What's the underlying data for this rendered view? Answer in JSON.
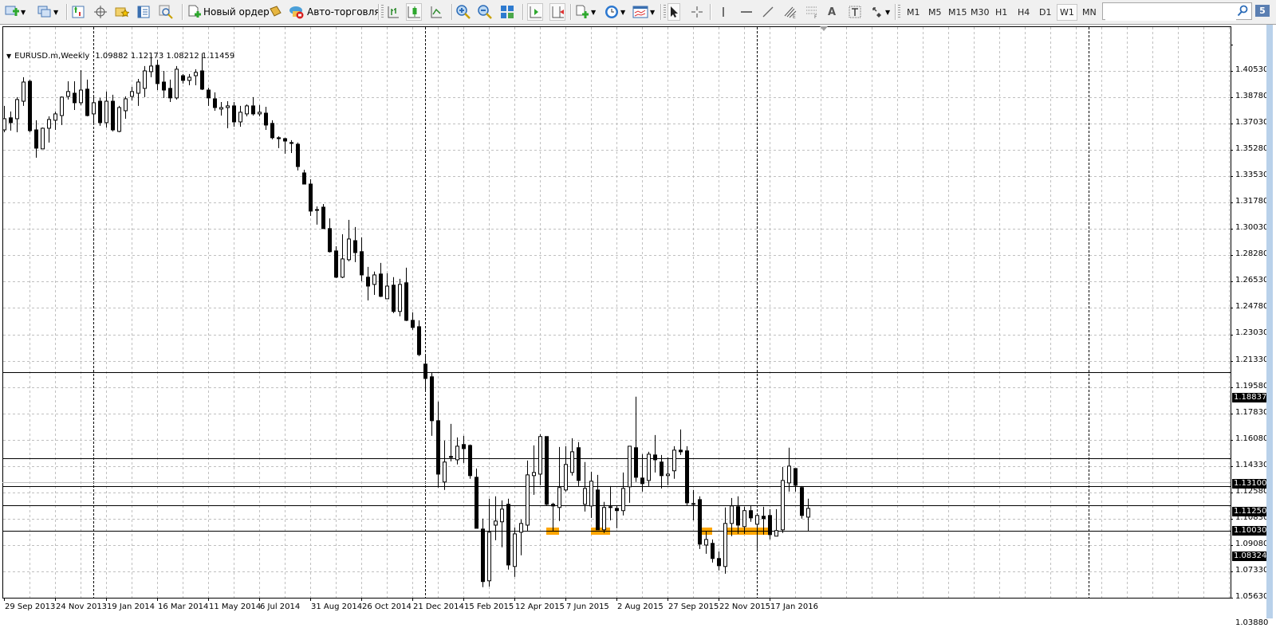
{
  "toolbar": {
    "new_order_label": "Новый ордер",
    "auto_trading_label": "Авто-торговля",
    "timeframes": [
      "M1",
      "M5",
      "M15",
      "M30",
      "H1",
      "H4",
      "D1",
      "W1",
      "MN"
    ],
    "active_timeframe": "W1",
    "search_value": "",
    "notification_count": "5",
    "icons": [
      "new-chart",
      "profiles",
      "market-watch",
      "navigator",
      "favorites",
      "terminal",
      "strategy-tester",
      "new-order",
      "metaeditor",
      "auto-trading",
      "bar-chart",
      "candlesticks",
      "line-chart",
      "zoom-in",
      "zoom-out",
      "tile-windows",
      "auto-scroll",
      "chart-shift",
      "indicators",
      "periods",
      "templates",
      "cursor",
      "crosshair",
      "vertical-line",
      "horizontal-line",
      "trendline",
      "fibonacci-fan",
      "fibonacci-retracement",
      "text",
      "text-label",
      "arrows",
      "search",
      "notifications"
    ]
  },
  "chart": {
    "symbol": "EURUSD.m,Weekly",
    "ohlc_text": "1.09882 1.12173 1.08212 1.11459"
  },
  "chart_data": {
    "type": "candlestick",
    "title": "EURUSD.m,Weekly",
    "first_bar_date": "2013-09-29",
    "bar_period": "W1",
    "ylim": [
      1.0388,
      1.4053
    ],
    "grid": true,
    "y_tick_labels": [
      "1.40530",
      "1.38780",
      "1.37030",
      "1.35280",
      "1.33530",
      "1.31780",
      "1.30030",
      "1.28280",
      "1.26530",
      "1.24780",
      "1.23030",
      "1.21330",
      "1.19580",
      "1.17830",
      "1.16080",
      "1.14330",
      "1.12580",
      "1.10830",
      "1.09080",
      "1.07330",
      "1.05630",
      "1.03880"
    ],
    "x_tick_labels": [
      "29 Sep 2013",
      "24 Nov 2013",
      "19 Jan 2014",
      "16 Mar 2014",
      "11 May 2014",
      "6 Jul 2014",
      "31 Aug 2014",
      "26 Oct 2014",
      "21 Dec 2014",
      "15 Feb 2015",
      "12 Apr 2015",
      "7 Jun 2015",
      "2 Aug 2015",
      "27 Sep 2015",
      "22 Nov 2015",
      "17 Jan 2016"
    ],
    "ohlc": [
      [
        1.3488,
        1.3647,
        1.3473,
        1.3562
      ],
      [
        1.3568,
        1.361,
        1.3483,
        1.3536
      ],
      [
        1.3562,
        1.3705,
        1.3473,
        1.3689
      ],
      [
        1.3678,
        1.3837,
        1.3647,
        1.3805
      ],
      [
        1.381,
        1.3821,
        1.3473,
        1.3483
      ],
      [
        1.3488,
        1.3552,
        1.3304,
        1.3367
      ],
      [
        1.3362,
        1.3504,
        1.3362,
        1.3499
      ],
      [
        1.3499,
        1.3578,
        1.3404,
        1.3557
      ],
      [
        1.3552,
        1.361,
        1.3488,
        1.3594
      ],
      [
        1.3583,
        1.371,
        1.352,
        1.3705
      ],
      [
        1.371,
        1.381,
        1.3689,
        1.3742
      ],
      [
        1.3731,
        1.381,
        1.362,
        1.3668
      ],
      [
        1.3668,
        1.3884,
        1.3652,
        1.3752
      ],
      [
        1.3758,
        1.3821,
        1.3578,
        1.3583
      ],
      [
        1.3594,
        1.3705,
        1.3531,
        1.3668
      ],
      [
        1.3678,
        1.37,
        1.3515,
        1.3536
      ],
      [
        1.3536,
        1.3742,
        1.3504,
        1.3678
      ],
      [
        1.3678,
        1.3721,
        1.3478,
        1.3488
      ],
      [
        1.3478,
        1.3647,
        1.3473,
        1.3636
      ],
      [
        1.3615,
        1.371,
        1.3562,
        1.3694
      ],
      [
        1.371,
        1.3773,
        1.3684,
        1.3742
      ],
      [
        1.3731,
        1.3826,
        1.3647,
        1.3805
      ],
      [
        1.3763,
        1.3911,
        1.3705,
        1.3879
      ],
      [
        1.3874,
        1.3969,
        1.3837,
        1.3911
      ],
      [
        1.3916,
        1.3953,
        1.3752,
        1.3795
      ],
      [
        1.3805,
        1.3879,
        1.37,
        1.3752
      ],
      [
        1.3763,
        1.3821,
        1.3673,
        1.37
      ],
      [
        1.37,
        1.3911,
        1.3689,
        1.389
      ],
      [
        1.3847,
        1.3858,
        1.3795,
        1.3816
      ],
      [
        1.3816,
        1.3858,
        1.3784,
        1.3837
      ],
      [
        1.3847,
        1.389,
        1.3784,
        1.3869
      ],
      [
        1.3879,
        1.3995,
        1.3752,
        1.3758
      ],
      [
        1.3752,
        1.3768,
        1.3647,
        1.37
      ],
      [
        1.3694,
        1.3737,
        1.3615,
        1.3636
      ],
      [
        1.3626,
        1.3673,
        1.3583,
        1.3636
      ],
      [
        1.3636,
        1.3678,
        1.3499,
        1.3647
      ],
      [
        1.3647,
        1.3673,
        1.3509,
        1.3541
      ],
      [
        1.3541,
        1.3647,
        1.3509,
        1.3605
      ],
      [
        1.3594,
        1.3657,
        1.3578,
        1.3647
      ],
      [
        1.3647,
        1.3705,
        1.3583,
        1.3594
      ],
      [
        1.3594,
        1.3652,
        1.3578,
        1.3605
      ],
      [
        1.3599,
        1.3641,
        1.3488,
        1.352
      ],
      [
        1.3531,
        1.3552,
        1.3425,
        1.3436
      ],
      [
        1.3436,
        1.3446,
        1.3367,
        1.343
      ],
      [
        1.343,
        1.3436,
        1.333,
        1.3414
      ],
      [
        1.3404,
        1.342,
        1.3335,
        1.3399
      ],
      [
        1.3393,
        1.3404,
        1.3219,
        1.3245
      ],
      [
        1.3203,
        1.3224,
        1.3129,
        1.3129
      ],
      [
        1.3129,
        1.3161,
        1.2918,
        1.295
      ],
      [
        1.296,
        1.2981,
        1.286,
        1.2955
      ],
      [
        1.2976,
        1.2997,
        1.2834,
        1.2834
      ],
      [
        1.2834,
        1.2902,
        1.2675,
        1.2681
      ],
      [
        1.2686,
        1.2717,
        1.2506,
        1.2512
      ],
      [
        1.2512,
        1.2797,
        1.2506,
        1.2633
      ],
      [
        1.2628,
        1.2892,
        1.2617,
        1.2765
      ],
      [
        1.2754,
        1.2844,
        1.2612,
        1.2675
      ],
      [
        1.2681,
        1.2776,
        1.2485,
        1.2527
      ],
      [
        1.2512,
        1.258,
        1.2358,
        1.2453
      ],
      [
        1.2464,
        1.2549,
        1.2395,
        1.2527
      ],
      [
        1.2533,
        1.2607,
        1.238,
        1.2385
      ],
      [
        1.2369,
        1.2538,
        1.2369,
        1.2453
      ],
      [
        1.2459,
        1.2512,
        1.2274,
        1.2285
      ],
      [
        1.2285,
        1.2501,
        1.2253,
        1.2464
      ],
      [
        1.2475,
        1.2575,
        1.2221,
        1.2226
      ],
      [
        1.2226,
        1.2279,
        1.2163,
        1.2179
      ],
      [
        1.2184,
        1.2226,
        1.1989,
        1.1999
      ],
      [
        1.1936,
        1.1994,
        1.1757,
        1.1841
      ],
      [
        1.1852,
        1.1878,
        1.1461,
        1.1561
      ],
      [
        1.1561,
        1.1688,
        1.1118,
        1.1207
      ],
      [
        1.1155,
        1.1429,
        1.1102,
        1.1287
      ],
      [
        1.1324,
        1.154,
        1.1292,
        1.1318
      ],
      [
        1.1302,
        1.145,
        1.1271,
        1.1392
      ],
      [
        1.1403,
        1.1461,
        1.1281,
        1.1376
      ],
      [
        1.1397,
        1.1403,
        1.1176,
        1.1197
      ],
      [
        1.1186,
        1.1244,
        1.0848,
        1.0848
      ],
      [
        1.0843,
        1.0912,
        1.0458,
        1.0495
      ],
      [
        1.05,
        1.1044,
        1.0462,
        1.0822
      ],
      [
        1.0869,
        1.106,
        1.0769,
        1.0896
      ],
      [
        1.0891,
        1.1033,
        1.0722,
        1.0975
      ],
      [
        1.1007,
        1.1044,
        1.0574,
        1.0605
      ],
      [
        1.0595,
        1.0854,
        1.0526,
        1.0811
      ],
      [
        1.0822,
        1.0906,
        1.0669,
        1.088
      ],
      [
        1.0869,
        1.1297,
        1.0827,
        1.1202
      ],
      [
        1.1197,
        1.1397,
        1.107,
        1.1218
      ],
      [
        1.1207,
        1.1471,
        1.1133,
        1.1456
      ],
      [
        1.1456,
        1.1456,
        1.1001,
        1.1007
      ],
      [
        1.1007,
        1.1017,
        1.0827,
        1.0996
      ],
      [
        1.0986,
        1.1387,
        1.0896,
        1.1118
      ],
      [
        1.1102,
        1.1392,
        1.1091,
        1.1271
      ],
      [
        1.1218,
        1.1445,
        1.1197,
        1.1355
      ],
      [
        1.1382,
        1.1419,
        1.1128,
        1.1165
      ],
      [
        1.1007,
        1.1287,
        1.0959,
        1.1112
      ],
      [
        1.0996,
        1.1223,
        1.0917,
        1.116
      ],
      [
        1.1102,
        1.1202,
        1.0838,
        1.0838
      ],
      [
        1.0838,
        1.1023,
        1.0817,
        1.0986
      ],
      [
        1.0991,
        1.1128,
        1.0901,
        1.0986
      ],
      [
        1.098,
        1.1001,
        1.0848,
        1.0965
      ],
      [
        1.0965,
        1.1218,
        1.0933,
        1.1112
      ],
      [
        1.1123,
        1.1392,
        1.1017,
        1.1392
      ],
      [
        1.1382,
        1.172,
        1.1155,
        1.1186
      ],
      [
        1.1181,
        1.1339,
        1.1091,
        1.1144
      ],
      [
        1.1165,
        1.1355,
        1.1128,
        1.1339
      ],
      [
        1.1334,
        1.1466,
        1.1218,
        1.1302
      ],
      [
        1.1287,
        1.1334,
        1.1112,
        1.1197
      ],
      [
        1.1197,
        1.1318,
        1.1133,
        1.1207
      ],
      [
        1.1229,
        1.1392,
        1.1176,
        1.1366
      ],
      [
        1.1366,
        1.1503,
        1.1334,
        1.1355
      ],
      [
        1.1361,
        1.1392,
        1.1001,
        1.1017
      ],
      [
        1.1012,
        1.1102,
        1.0901,
        1.1007
      ],
      [
        1.1038,
        1.106,
        1.0711,
        1.0743
      ],
      [
        1.0737,
        1.0827,
        1.0679,
        1.0774
      ],
      [
        1.0748,
        1.0774,
        1.0621,
        1.0648
      ],
      [
        1.0648,
        1.0695,
        1.0569,
        1.06
      ],
      [
        1.0595,
        1.0986,
        1.0547,
        1.088
      ],
      [
        1.088,
        1.1049,
        1.0796,
        1.0996
      ],
      [
        1.0991,
        1.106,
        1.0811,
        1.0869
      ],
      [
        1.0859,
        1.0991,
        1.0811,
        1.0965
      ],
      [
        1.0965,
        1.1001,
        1.0891,
        1.0917
      ],
      [
        1.0875,
        1.0933,
        1.0711,
        1.0933
      ],
      [
        1.0928,
        1.0991,
        1.0806,
        1.0912
      ],
      [
        1.0933,
        1.0975,
        1.0774,
        1.0806
      ],
      [
        1.0796,
        1.0975,
        1.0796,
        1.0833
      ],
      [
        1.0838,
        1.1255,
        1.0817,
        1.1165
      ],
      [
        1.1149,
        1.1382,
        1.1091,
        1.126
      ],
      [
        1.1244,
        1.1244,
        1.1091,
        1.1133
      ],
      [
        1.1118,
        1.1128,
        1.0912,
        1.0933
      ],
      [
        1.0922,
        1.1044,
        1.0827,
        1.098
      ]
    ],
    "horizontal_lines": [
      {
        "price": 1.18837,
        "label": "1.18837"
      },
      {
        "price": 1.131,
        "label": "1.13100"
      },
      {
        "price": 1.1125,
        "label": "1.11250"
      },
      {
        "price": 1.1003,
        "label": "1.10030"
      },
      {
        "price": 1.08324,
        "label": "1.08324"
      }
    ],
    "grey_line_price": 1.1152,
    "zones": [
      {
        "from": "2015-05-17",
        "to": "2015-05-31",
        "top": 1.0853,
        "bottom": 1.0805
      },
      {
        "from": "2015-07-05",
        "to": "2015-07-26",
        "top": 1.0853,
        "bottom": 1.0805
      },
      {
        "from": "2015-11-01",
        "to": "2015-11-15",
        "top": 1.0853,
        "bottom": 1.0805
      },
      {
        "from": "2015-11-29",
        "to": "2016-01-17",
        "top": 1.0853,
        "bottom": 1.0805
      }
    ],
    "colors": {
      "bull_body": "#ffffff",
      "bear_body": "#000000",
      "outline": "#000000",
      "grid": "#c0c0c0",
      "zone": "#ffa500",
      "line": "#000000",
      "grey_line": "#c0c0c0"
    }
  }
}
